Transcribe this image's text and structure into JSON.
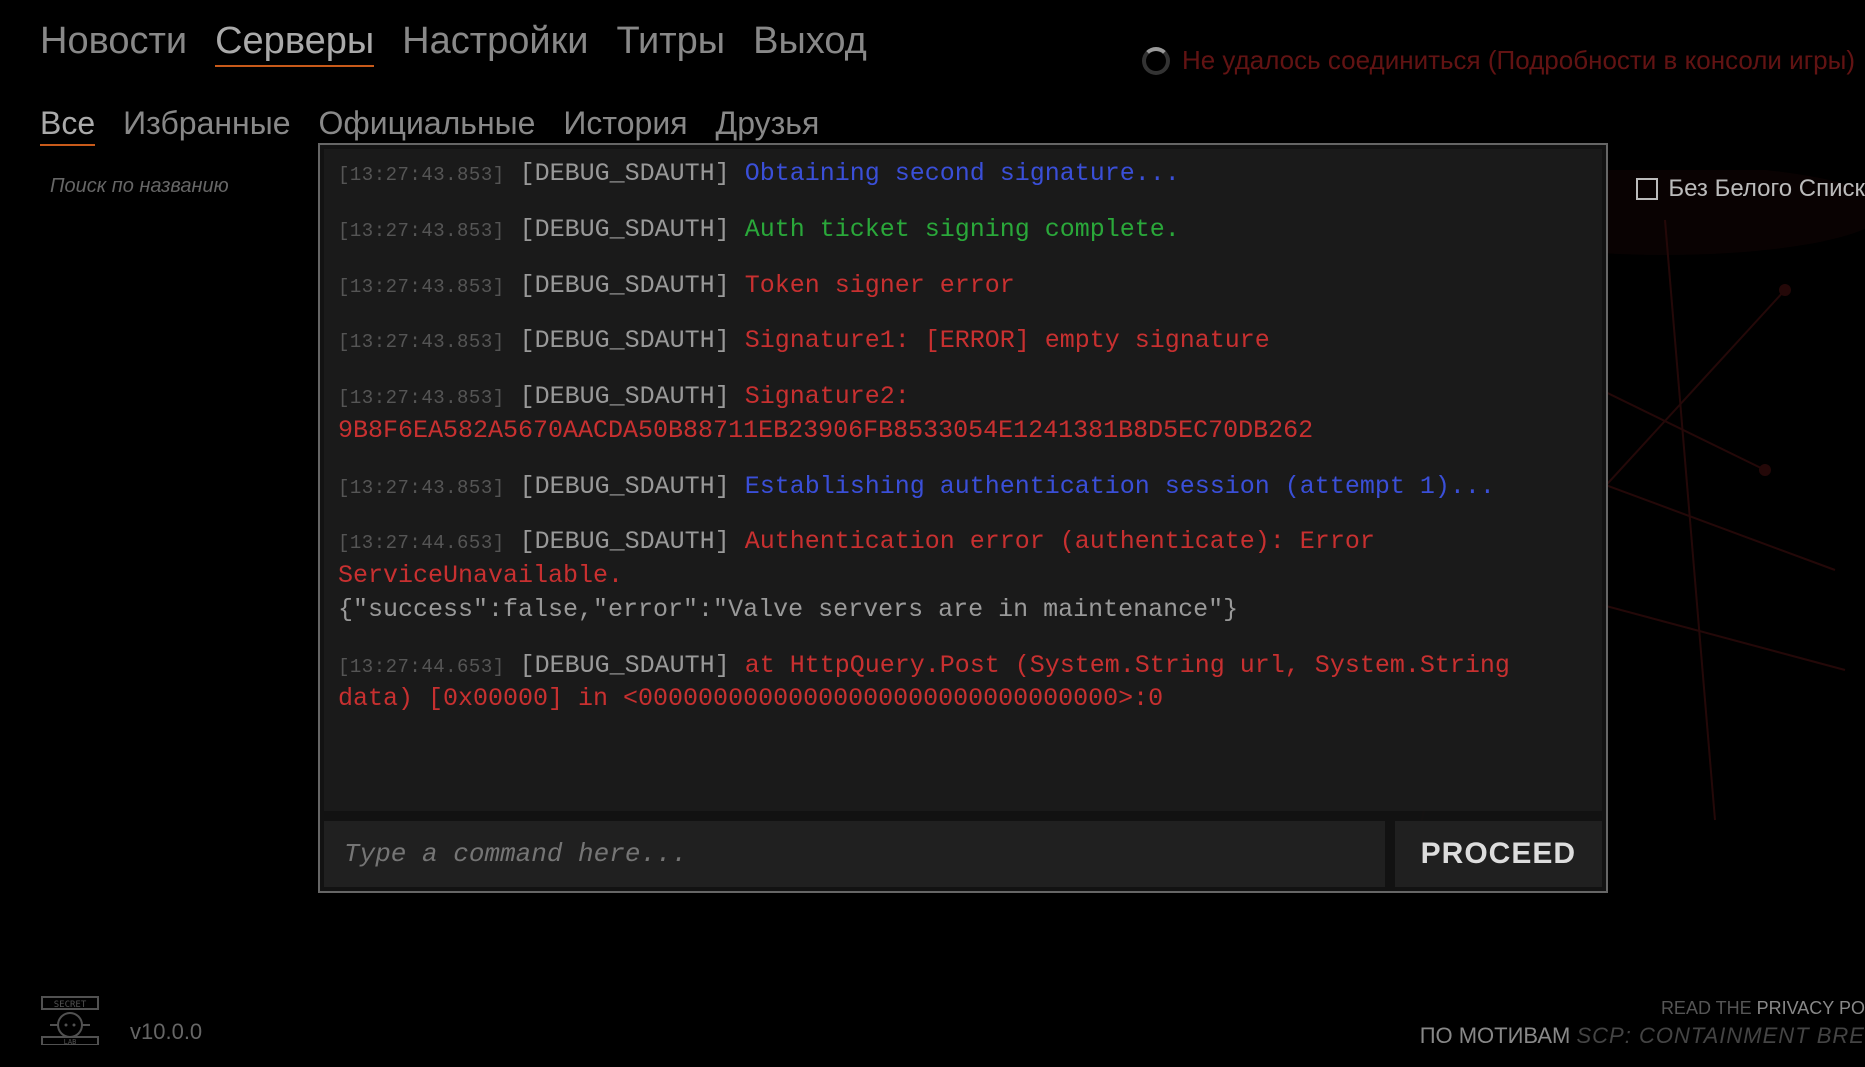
{
  "nav": {
    "items": [
      "Новости",
      "Серверы",
      "Настройки",
      "Титры",
      "Выход"
    ],
    "active_index": 1
  },
  "connection": {
    "text": "Не удалось соединиться (Подробности в консоли игры)"
  },
  "sub_nav": {
    "items": [
      "Все",
      "Избранные",
      "Официальные",
      "История",
      "Друзья"
    ],
    "active_index": 0
  },
  "search": {
    "placeholder": "Поиск по названию"
  },
  "whitelist": {
    "label": "Без Белого Списк"
  },
  "console": {
    "input_placeholder": "Type a command here...",
    "proceed_label": "PROCEED",
    "lines": [
      {
        "ts": "[13:27:43.853]",
        "tag": "[DEBUG_SDAUTH]",
        "cls": "msg-blue",
        "msg": "Obtaining second signature..."
      },
      {
        "ts": "[13:27:43.853]",
        "tag": "[DEBUG_SDAUTH]",
        "cls": "msg-green",
        "msg": "Auth ticket signing complete."
      },
      {
        "ts": "[13:27:43.853]",
        "tag": "[DEBUG_SDAUTH]",
        "cls": "msg-red",
        "msg": "Token signer error"
      },
      {
        "ts": "[13:27:43.853]",
        "tag": "[DEBUG_SDAUTH]",
        "cls": "msg-red",
        "msg": "Signature1: [ERROR] empty signature"
      },
      {
        "ts": "[13:27:43.853]",
        "tag": "[DEBUG_SDAUTH]",
        "cls": "msg-red",
        "msg": "Signature2: 9B8F6EA582A5670AACDA50B88711EB23906FB8533054E1241381B8D5EC70DB262"
      },
      {
        "ts": "[13:27:43.853]",
        "tag": "[DEBUG_SDAUTH]",
        "cls": "msg-blue",
        "msg": "Establishing authentication session (attempt 1)..."
      },
      {
        "ts": "[13:27:44.653]",
        "tag": "[DEBUG_SDAUTH]",
        "cls": "msg-red",
        "msg": "Authentication error (authenticate): Error ServiceUnavailable.",
        "extra": "{\"success\":false,\"error\":\"Valve servers are in maintenance\"}",
        "extra_cls": "msg-grey"
      },
      {
        "ts": "[13:27:44.653]",
        "tag": "[DEBUG_SDAUTH]",
        "cls": "msg-red",
        "msg": "  at HttpQuery.Post (System.String url, System.String data) [0x00000] in <00000000000000000000000000000000>:0"
      }
    ]
  },
  "footer": {
    "version": "v10.0.0",
    "privacy_prefix": "READ THE ",
    "privacy_link": "PRIVACY PO",
    "motive_prefix": "ПО МОТИВАМ ",
    "motive_title": "SCP: CONTAINMENT BRE"
  }
}
